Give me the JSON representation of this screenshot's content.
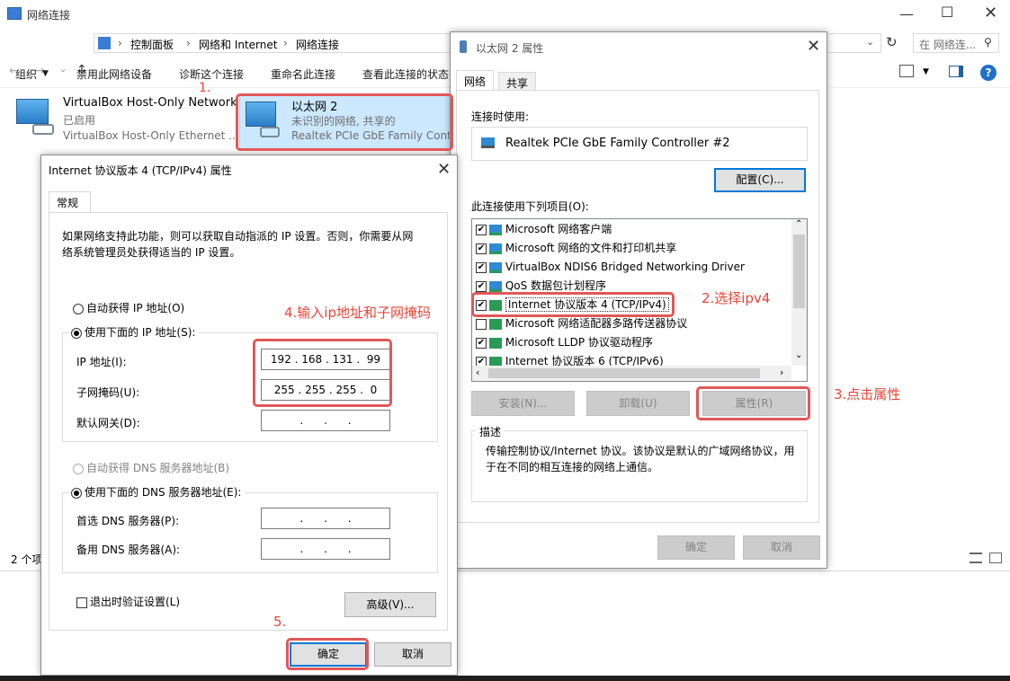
{
  "explorer": {
    "title": "网络连接",
    "breadcrumb": [
      "控制面板",
      "网络和 Internet",
      "网络连接"
    ],
    "search_placeholder": "在 网络连...",
    "commands": [
      "组织",
      "禁用此网络设备",
      "诊断这个连接",
      "重命名此连接",
      "查看此连接的状态"
    ],
    "status": "2 个项",
    "items": [
      {
        "title": "VirtualBox Host-Only Network",
        "status": "已启用",
        "device": "VirtualBox Host-Only Ethernet ..."
      },
      {
        "title": "以太网 2",
        "status": "未识别的网络, 共享的",
        "device": "Realtek PCIe GbE Family Contr"
      }
    ]
  },
  "eth_dialog": {
    "title": "以太网 2 属性",
    "tabs": [
      "网络",
      "共享"
    ],
    "connect_using_label": "连接时使用:",
    "adapter": "Realtek PCIe GbE Family Controller #2",
    "configure_label": "配置(C)...",
    "items_label": "此连接使用下列项目(O):",
    "items": [
      {
        "label": "Microsoft 网络客户端",
        "checked": "✔"
      },
      {
        "label": "Microsoft 网络的文件和打印机共享",
        "checked": "✔"
      },
      {
        "label": "VirtualBox NDIS6 Bridged Networking Driver",
        "checked": "✔"
      },
      {
        "label": "QoS 数据包计划程序",
        "checked": "✔"
      },
      {
        "label": "Internet 协议版本 4 (TCP/IPv4)",
        "checked": "✔"
      },
      {
        "label": "Microsoft 网络适配器多路传送器协议",
        "checked": ""
      },
      {
        "label": "Microsoft LLDP 协议驱动程序",
        "checked": "✔"
      },
      {
        "label": "Internet 协议版本 6 (TCP/IPv6)",
        "checked": "✔"
      }
    ],
    "install_label": "安装(N)...",
    "uninstall_label": "卸载(U)",
    "properties_label": "属性(R)",
    "description_label": "描述",
    "description": "传输控制协议/Internet 协议。该协议是默认的广域网络协议，用于在不同的相互连接的网络上通信。",
    "ok_label": "确定",
    "cancel_label": "取消"
  },
  "ipv4_dialog": {
    "title": "Internet 协议版本 4 (TCP/IPv4) 属性",
    "tab": "常规",
    "intro": "如果网络支持此功能，则可以获取自动指派的 IP 设置。否则，你需要从网络系统管理员处获得适当的 IP 设置。",
    "auto_ip_label": "自动获得 IP 地址(O)",
    "manual_ip_label": "使用下面的 IP 地址(S):",
    "ip_label": "IP 地址(I):",
    "ip_value": "192 . 168 . 131 .  99",
    "mask_label": "子网掩码(U):",
    "mask_value": "255 . 255 . 255 .  0",
    "gateway_label": "默认网关(D):",
    "empty_ip": ".      .      .",
    "auto_dns_label": "自动获得 DNS 服务器地址(B)",
    "manual_dns_label": "使用下面的 DNS 服务器地址(E):",
    "pref_dns_label": "首选 DNS 服务器(P):",
    "alt_dns_label": "备用 DNS 服务器(A):",
    "validate_label": "退出时验证设置(L)",
    "advanced_label": "高级(V)...",
    "ok_label": "确定",
    "cancel_label": "取消"
  },
  "annotations": {
    "step1": "1.",
    "step2": "2.选择ipv4",
    "step3": "3.点击属性",
    "step4": "4.输入ip地址和子网掩码",
    "step5": "5."
  },
  "colors": {
    "annotation": "#e0585a",
    "accent": "#0078d7"
  }
}
